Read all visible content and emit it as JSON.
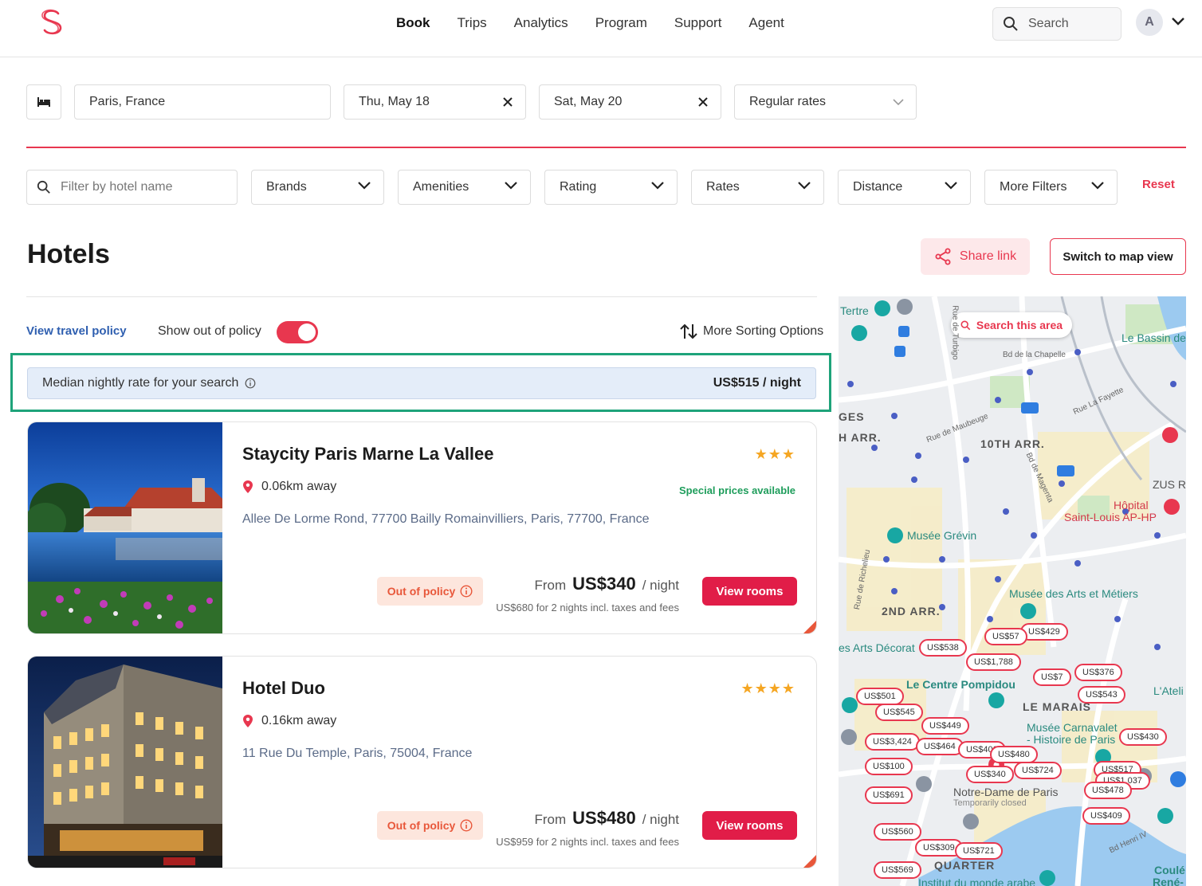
{
  "nav": {
    "items": [
      "Book",
      "Trips",
      "Analytics",
      "Program",
      "Support",
      "Agent"
    ],
    "active": "Book",
    "search_placeholder": "Search",
    "avatar_initial": "A"
  },
  "search": {
    "destination": "Paris, France",
    "check_in": "Thu, May 18",
    "check_out": "Sat, May 20",
    "rate_type": "Regular rates"
  },
  "filters": {
    "hotel_name_placeholder": "Filter by hotel name",
    "brands": "Brands",
    "amenities": "Amenities",
    "rating": "Rating",
    "rates": "Rates",
    "distance": "Distance",
    "more": "More Filters",
    "reset": "Reset"
  },
  "page": {
    "title": "Hotels",
    "share_label": "Share link",
    "map_view_label": "Switch to map view",
    "travel_policy_link": "View travel policy",
    "out_of_policy_label": "Show out of policy",
    "out_of_policy_on": true,
    "sorting_label": "More Sorting Options"
  },
  "median": {
    "label": "Median nightly rate for your search",
    "value": "US$515 / night"
  },
  "hotels": [
    {
      "name": "Staycity Paris Marne La Vallee",
      "stars": "★★★",
      "distance": "0.06km away",
      "special": "Special prices available",
      "address": "Allee De Lorme Rond, 77700 Bailly Romainvilliers, Paris, 77700, France",
      "policy": "Out of policy",
      "from": "From",
      "price": "US$340",
      "per": "/ night",
      "total": "US$680 for 2 nights incl. taxes and fees",
      "button": "View rooms"
    },
    {
      "name": "Hotel Duo",
      "stars": "★★★★",
      "distance": "0.16km away",
      "special": "",
      "address": "11 Rue Du Temple, Paris, 75004, France",
      "policy": "Out of policy",
      "from": "From",
      "price": "US$480",
      "per": "/ night",
      "total": "US$959 for 2 nights incl. taxes and fees",
      "button": "View rooms"
    }
  ],
  "map": {
    "search_area": "Search this area",
    "labels": [
      "Tertre",
      "Le Bassin de",
      "GES",
      "H ARR.",
      "10TH ARR.",
      "ZUS R",
      "Hôpital",
      "Saint-Louis AP-HP",
      "Musée Grévin",
      "Musée des Arts et Métiers",
      "2ND ARR.",
      "es Arts Décorat",
      "Le Centre Pompidou",
      "LE MARAIS",
      "L'Ateli",
      "Musée Carnavalet",
      "- Histoire de Paris",
      "Notre-Dame de Paris",
      "Temporarily closed",
      "QUARTER",
      "Institut du monde arabe",
      "Coulé",
      "René-",
      "Bd de la Chapelle",
      "Rue La Fayette",
      "Rue de Maubeuge",
      "Bd de Magenta",
      "Rue de Richelieu",
      "Bd Henri IV",
      "Rue de Turbigo"
    ],
    "prices": [
      "US$429",
      "US$57",
      "US$538",
      "US$1,788",
      "US$376",
      "US$7",
      "US$543",
      "US$501",
      "US$545",
      "US$449",
      "US$3,424",
      "US$464",
      "US$400",
      "US$480",
      "US$430",
      "US$100",
      "US$340",
      "US$724",
      "US$517",
      "US$1,037",
      "US$691",
      "US$478",
      "US$409",
      "US$560",
      "US$309",
      "US$721",
      "US$569"
    ]
  },
  "colors": {
    "brand": "#e8374f",
    "accent_button": "#e11d48",
    "highlight_border": "#1ea37a",
    "median_bg": "#e4edf9",
    "star": "#f5a623",
    "special": "#1e9d5b"
  }
}
